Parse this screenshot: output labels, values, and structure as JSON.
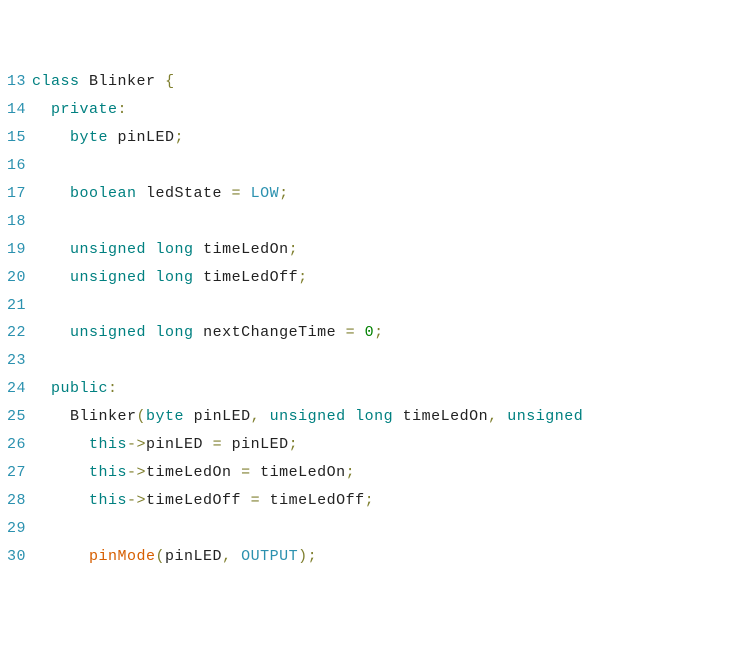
{
  "lines": [
    {
      "num": "13",
      "tokens": [
        {
          "cls": "kw",
          "t": "class"
        },
        {
          "cls": "id",
          "t": " "
        },
        {
          "cls": "cls",
          "t": "Blinker"
        },
        {
          "cls": "id",
          "t": " "
        },
        {
          "cls": "op",
          "t": "{"
        }
      ]
    },
    {
      "num": "14",
      "tokens": [
        {
          "cls": "id",
          "t": "  "
        },
        {
          "cls": "kw",
          "t": "private"
        },
        {
          "cls": "op",
          "t": ":"
        }
      ]
    },
    {
      "num": "15",
      "tokens": [
        {
          "cls": "id",
          "t": "    "
        },
        {
          "cls": "ty",
          "t": "byte"
        },
        {
          "cls": "id",
          "t": " pinLED"
        },
        {
          "cls": "op",
          "t": ";"
        }
      ]
    },
    {
      "num": "16",
      "tokens": []
    },
    {
      "num": "17",
      "tokens": [
        {
          "cls": "id",
          "t": "    "
        },
        {
          "cls": "ty",
          "t": "boolean"
        },
        {
          "cls": "id",
          "t": " ledState "
        },
        {
          "cls": "op",
          "t": "="
        },
        {
          "cls": "id",
          "t": " "
        },
        {
          "cls": "cnst",
          "t": "LOW"
        },
        {
          "cls": "op",
          "t": ";"
        }
      ]
    },
    {
      "num": "18",
      "tokens": []
    },
    {
      "num": "19",
      "tokens": [
        {
          "cls": "id",
          "t": "    "
        },
        {
          "cls": "ty",
          "t": "unsigned"
        },
        {
          "cls": "id",
          "t": " "
        },
        {
          "cls": "ty",
          "t": "long"
        },
        {
          "cls": "id",
          "t": " timeLedOn"
        },
        {
          "cls": "op",
          "t": ";"
        }
      ]
    },
    {
      "num": "20",
      "tokens": [
        {
          "cls": "id",
          "t": "    "
        },
        {
          "cls": "ty",
          "t": "unsigned"
        },
        {
          "cls": "id",
          "t": " "
        },
        {
          "cls": "ty",
          "t": "long"
        },
        {
          "cls": "id",
          "t": " timeLedOff"
        },
        {
          "cls": "op",
          "t": ";"
        }
      ]
    },
    {
      "num": "21",
      "tokens": []
    },
    {
      "num": "22",
      "tokens": [
        {
          "cls": "id",
          "t": "    "
        },
        {
          "cls": "ty",
          "t": "unsigned"
        },
        {
          "cls": "id",
          "t": " "
        },
        {
          "cls": "ty",
          "t": "long"
        },
        {
          "cls": "id",
          "t": " nextChangeTime "
        },
        {
          "cls": "op",
          "t": "="
        },
        {
          "cls": "id",
          "t": " "
        },
        {
          "cls": "num",
          "t": "0"
        },
        {
          "cls": "op",
          "t": ";"
        }
      ]
    },
    {
      "num": "23",
      "tokens": []
    },
    {
      "num": "24",
      "tokens": [
        {
          "cls": "id",
          "t": "  "
        },
        {
          "cls": "kw",
          "t": "public"
        },
        {
          "cls": "op",
          "t": ":"
        }
      ]
    },
    {
      "num": "25",
      "tokens": [
        {
          "cls": "id",
          "t": "    Blinker"
        },
        {
          "cls": "op",
          "t": "("
        },
        {
          "cls": "ty",
          "t": "byte"
        },
        {
          "cls": "id",
          "t": " pinLED"
        },
        {
          "cls": "op",
          "t": ","
        },
        {
          "cls": "id",
          "t": " "
        },
        {
          "cls": "ty",
          "t": "unsigned"
        },
        {
          "cls": "id",
          "t": " "
        },
        {
          "cls": "ty",
          "t": "long"
        },
        {
          "cls": "id",
          "t": " timeLedOn"
        },
        {
          "cls": "op",
          "t": ","
        },
        {
          "cls": "id",
          "t": " "
        },
        {
          "cls": "ty",
          "t": "unsigned"
        }
      ]
    },
    {
      "num": "26",
      "tokens": [
        {
          "cls": "id",
          "t": "      "
        },
        {
          "cls": "kw",
          "t": "this"
        },
        {
          "cls": "op",
          "t": "->"
        },
        {
          "cls": "id",
          "t": "pinLED "
        },
        {
          "cls": "op",
          "t": "="
        },
        {
          "cls": "id",
          "t": " pinLED"
        },
        {
          "cls": "op",
          "t": ";"
        }
      ]
    },
    {
      "num": "27",
      "tokens": [
        {
          "cls": "id",
          "t": "      "
        },
        {
          "cls": "kw",
          "t": "this"
        },
        {
          "cls": "op",
          "t": "->"
        },
        {
          "cls": "id",
          "t": "timeLedOn "
        },
        {
          "cls": "op",
          "t": "="
        },
        {
          "cls": "id",
          "t": " timeLedOn"
        },
        {
          "cls": "op",
          "t": ";"
        }
      ]
    },
    {
      "num": "28",
      "tokens": [
        {
          "cls": "id",
          "t": "      "
        },
        {
          "cls": "kw",
          "t": "this"
        },
        {
          "cls": "op",
          "t": "->"
        },
        {
          "cls": "id",
          "t": "timeLedOff "
        },
        {
          "cls": "op",
          "t": "="
        },
        {
          "cls": "id",
          "t": " timeLedOff"
        },
        {
          "cls": "op",
          "t": ";"
        }
      ]
    },
    {
      "num": "29",
      "tokens": []
    },
    {
      "num": "30",
      "tokens": [
        {
          "cls": "id",
          "t": "      "
        },
        {
          "cls": "fn",
          "t": "pinMode"
        },
        {
          "cls": "op",
          "t": "("
        },
        {
          "cls": "id",
          "t": "pinLED"
        },
        {
          "cls": "op",
          "t": ","
        },
        {
          "cls": "id",
          "t": " "
        },
        {
          "cls": "cnst",
          "t": "OUTPUT"
        },
        {
          "cls": "op",
          "t": ")"
        },
        {
          "cls": "op",
          "t": ";"
        }
      ]
    }
  ]
}
